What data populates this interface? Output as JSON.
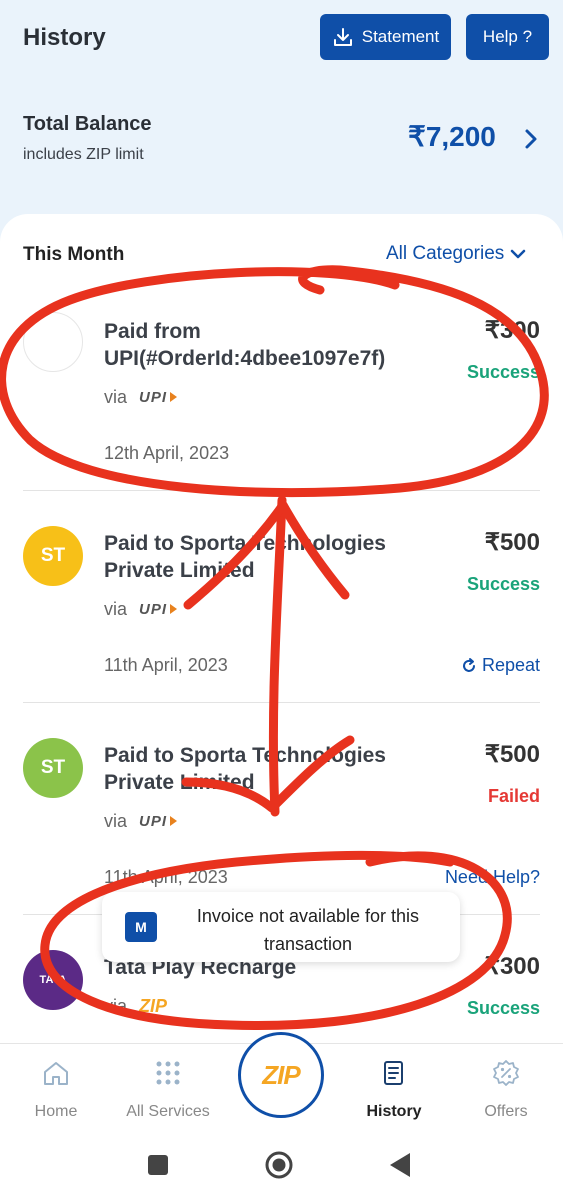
{
  "header": {
    "title": "History",
    "statement_label": "Statement",
    "help_label": "Help ?"
  },
  "balance": {
    "title": "Total Balance",
    "subtitle": "includes ZIP limit",
    "amount": "₹7,200"
  },
  "filters": {
    "period_label": "This Month",
    "category_label": "All Categories"
  },
  "transactions": [
    {
      "avatar": "",
      "avatar_color": "#ffffff",
      "title": "Paid from UPI(#OrderId:4dbee1097e7f)",
      "via_label": "via",
      "method": "UPI",
      "date": "12th April, 2023",
      "amount": "₹300",
      "status": "Success",
      "status_color": "#1aa37a",
      "action": ""
    },
    {
      "avatar": "ST",
      "avatar_color": "#f7c018",
      "title": "Paid to Sporta Technologies Private Limited",
      "via_label": "via",
      "method": "UPI",
      "date": "11th April, 2023",
      "amount": "₹500",
      "status": "Success",
      "status_color": "#1aa37a",
      "action": "Repeat"
    },
    {
      "avatar": "ST",
      "avatar_color": "#8bc34a",
      "title": "Paid to Sporta Technologies Private Limited",
      "via_label": "via",
      "method": "UPI",
      "date": "11th April, 2023",
      "amount": "₹500",
      "status": "Failed",
      "status_color": "#e53935",
      "action": "Need Help?"
    },
    {
      "avatar": "TATA",
      "avatar_color": "#5b2a86",
      "title": "Tata Play Recharge",
      "via_label": "via",
      "method": "ZIP",
      "date": "",
      "amount": "₹300",
      "status": "Success",
      "status_color": "#1aa37a",
      "action": ""
    }
  ],
  "toast": {
    "text": "Invoice not available for this transaction",
    "icon": "mobikwik-icon"
  },
  "nav": {
    "items": [
      {
        "label": "Home",
        "icon": "home-icon"
      },
      {
        "label": "All Services",
        "icon": "grid-icon"
      },
      {
        "label": "ZIP",
        "icon": "zip-icon"
      },
      {
        "label": "History",
        "icon": "history-icon"
      },
      {
        "label": "Offers",
        "icon": "offers-icon"
      }
    ]
  },
  "colors": {
    "accent": "#0f4fa8",
    "background_top": "#eaf3fb",
    "annotation": "#e8321e"
  }
}
